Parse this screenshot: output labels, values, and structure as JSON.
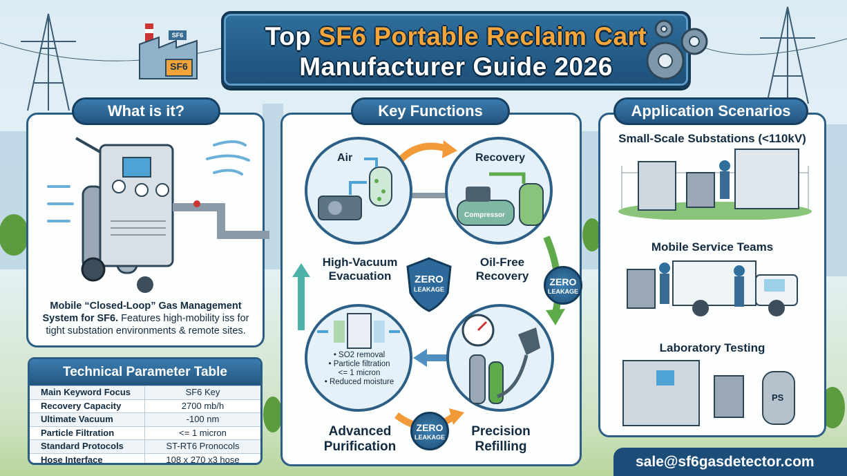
{
  "title": {
    "line1_pre": "Top ",
    "line1_highlight": "SF6 Portable Reclaim Cart",
    "line2": "Manufacturer Guide 2026"
  },
  "factory_sign": "SF6",
  "factory_roof_sign": "SF6",
  "what": {
    "heading": "What is it?",
    "desc_bold": "Mobile “Closed-Loop” Gas Management System for SF6.",
    "desc_rest": " Features high-mobility iss for tight substation environments & remote sites."
  },
  "table": {
    "heading": "Technical Parameter Table",
    "rows": [
      {
        "k": "Main Keyword Focus",
        "v": "SF6 Key"
      },
      {
        "k": "Recovery Capacity",
        "v": "2700 mb/h"
      },
      {
        "k": "Ultimate Vacuum",
        "v": "-100 nm"
      },
      {
        "k": "Particle Filtration",
        "v": "<= 1 micron"
      },
      {
        "k": "Standard Protocols",
        "v": "ST-RT6 Pronocols"
      },
      {
        "k": "Hose Interface",
        "v": "108 x 270 x3 hose"
      }
    ]
  },
  "functions": {
    "heading": "Key Functions",
    "air": "Air",
    "recovery": "Recovery",
    "compressor": "Compressor",
    "vacuum_l1": "High-Vacuum",
    "vacuum_l2": "Evacuation",
    "oilfree_l1": "Oil-Free",
    "oilfree_l2": "Recovery",
    "purif_items": [
      "• SO2 removal",
      "• Particle filtration",
      "<= 1 micron",
      "• Reduced moisture"
    ],
    "purif_l1": "Advanced",
    "purif_l2": "Purification",
    "refill_l1": "Precision",
    "refill_l2": "Refilling",
    "zero": "ZERO",
    "leakage": "LEAKAGE"
  },
  "apps": {
    "heading": "Application Scenarios",
    "s1": "Small-Scale Substations (<110kV)",
    "s2": "Mobile Service Teams",
    "s3": "Laboratory Testing",
    "ps_label": "PS"
  },
  "email": "sale@sf6gasdetector.com"
}
